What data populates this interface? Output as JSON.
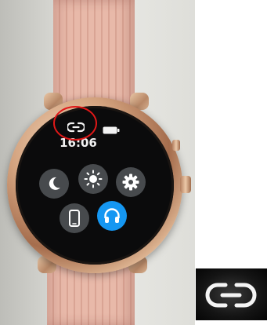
{
  "watch_screen": {
    "time": "16:06",
    "status_icons": [
      "link-icon",
      "battery-icon"
    ],
    "quick_buttons": [
      {
        "icon": "moon-icon"
      },
      {
        "icon": "sun-icon"
      },
      {
        "icon": "gear-icon"
      },
      {
        "icon": "phone-icon"
      },
      {
        "icon": "headphones-icon",
        "active": true
      }
    ]
  },
  "annotation": {
    "shape": "circle",
    "color": "#e01818",
    "target": "link-icon"
  },
  "zoom_inset": {
    "icon": "link-icon"
  },
  "colors": {
    "screen_background": "#0b0b0c",
    "button_gray": "#474a4d",
    "active_blue": "#1597f2",
    "strap_pink": "#e8b9a9",
    "case_rose_gold": "#d2a17d"
  }
}
